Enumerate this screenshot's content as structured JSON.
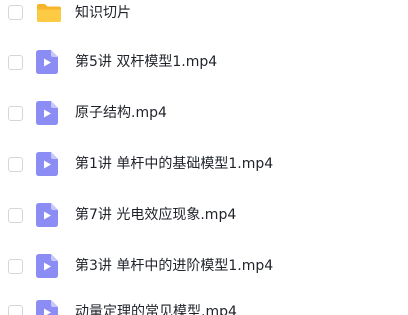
{
  "files": [
    {
      "name": "知识切片",
      "type": "folder",
      "icon": "folder-icon"
    },
    {
      "name": "第5讲 双杆模型1.mp4",
      "type": "video",
      "icon": "video-file-icon"
    },
    {
      "name": "原子结构.mp4",
      "type": "video",
      "icon": "video-file-icon"
    },
    {
      "name": "第1讲 单杆中的基础模型1.mp4",
      "type": "video",
      "icon": "video-file-icon"
    },
    {
      "name": "第7讲 光电效应现象.mp4",
      "type": "video",
      "icon": "video-file-icon"
    },
    {
      "name": "第3讲 单杆中的进阶模型1.mp4",
      "type": "video",
      "icon": "video-file-icon"
    },
    {
      "name": "动量定理的常见模型.mp4",
      "type": "video",
      "icon": "video-file-icon"
    }
  ],
  "colors": {
    "folder": "#fccb43",
    "folder_tab": "#f7b52c",
    "video_icon": "#8b8df4",
    "video_fold": "#c6c7fa",
    "text": "#1f2329",
    "checkbox_border": "#d4d6dc"
  }
}
